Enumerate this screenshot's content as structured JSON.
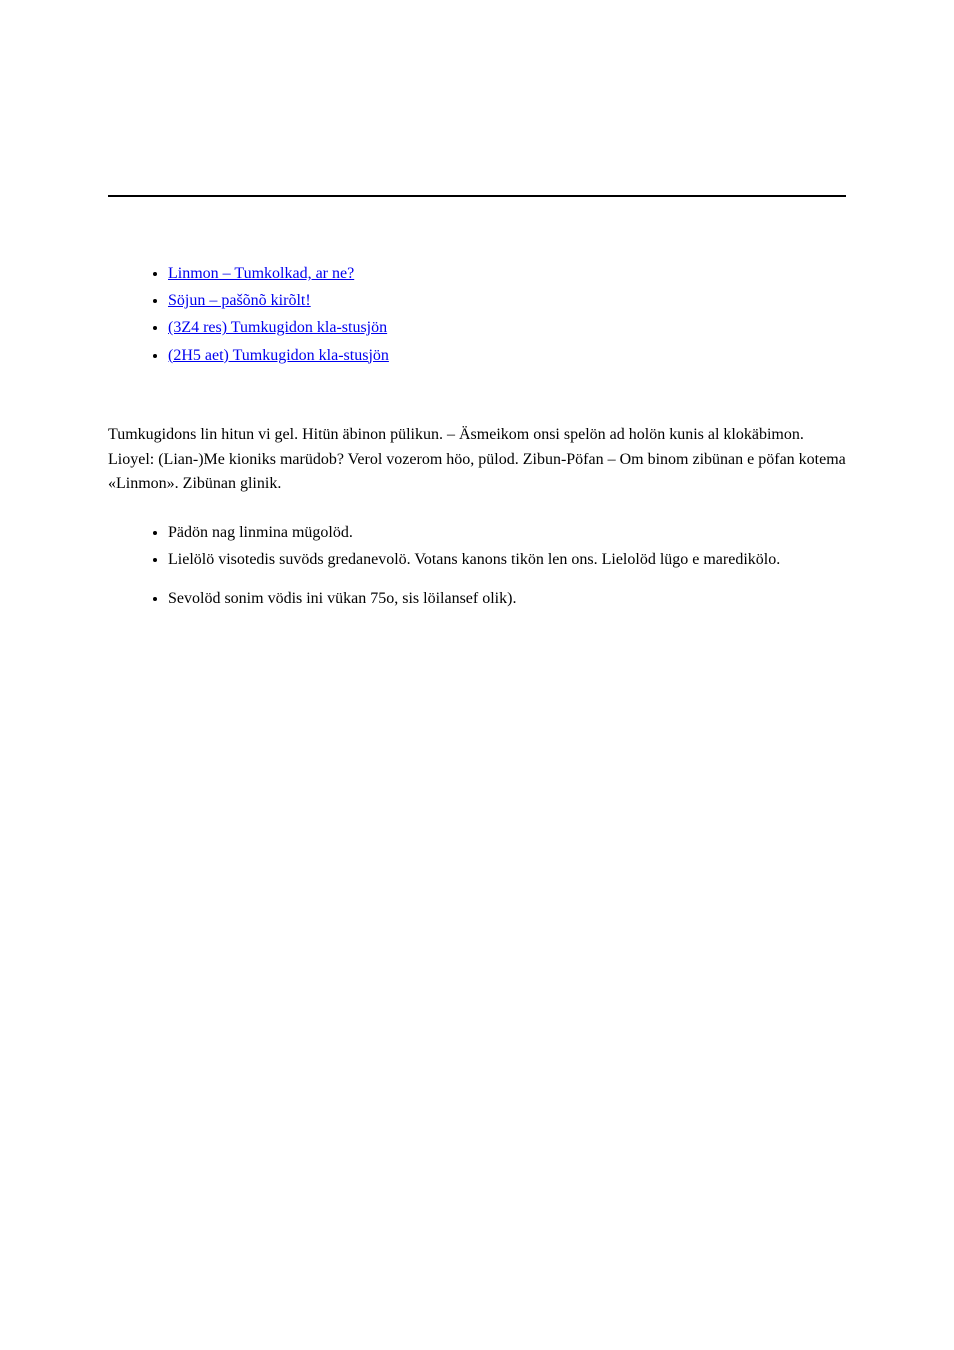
{
  "links": [
    {
      "text": "Linmon – Tumkolkad, ar ne?"
    },
    {
      "text": "Söjun – pašõnõ kirõlt!"
    },
    {
      "text": "(3Z4 res) Tumkugidon kla-stusjön"
    },
    {
      "text": "(2H5 aet) Tumkugidon kla-stusjön"
    }
  ],
  "intro": "Tumkugidons lin hitun vi gel. Hitün äbinon pülikun. – Äsmeikom onsi spelön ad holön kunis al klokäbimon. Lioyel: (Lian-)Me kioniks marüdob? Verol vozerom höo, pülod. Zibun-Pöfan – Om binom zibünan e pöfan kotema «Linmon». Zibünan glinik.",
  "rules": [
    "Pädön nag linmina mügolöd.",
    "Lielölö visotedis suvöds gredanevolö. Votans kanons tikön len ons. Lielolöd lügo e maredikölo.",
    "Sevolöd sonim vödis ini vükan 75o, sis löilansef olik)."
  ]
}
